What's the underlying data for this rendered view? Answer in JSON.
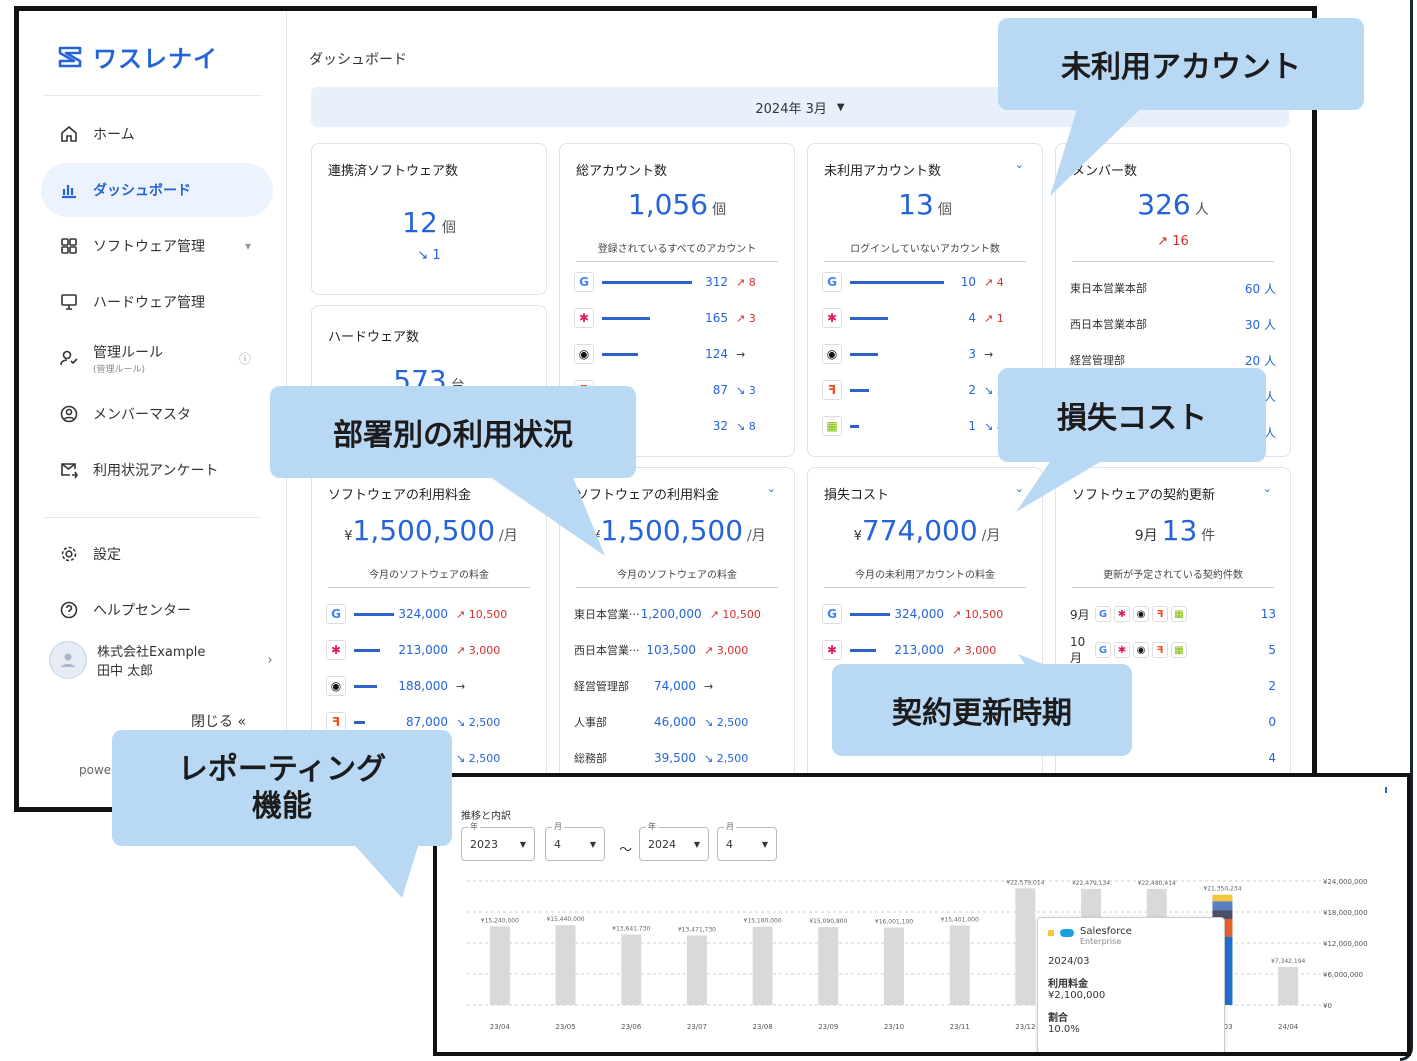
{
  "brand": {
    "name": "ワスレナイ"
  },
  "sidebar": {
    "items": [
      {
        "label": "ホーム"
      },
      {
        "label": "ダッシュボード"
      },
      {
        "label": "ソフトウェア管理"
      },
      {
        "label": "ハードウェア管理"
      },
      {
        "label": "管理ルール",
        "sub": "(管理ルール)"
      },
      {
        "label": "メンバーマスタ"
      },
      {
        "label": "利用状況アンケート"
      },
      {
        "label": "設定"
      },
      {
        "label": "ヘルプセンター"
      }
    ],
    "user_company": "株式会社Example",
    "user_name": "田中 太郎",
    "close_label": "閉じる",
    "close_icon": "«",
    "powered": "powe"
  },
  "header": {
    "title": "ダッシュボード",
    "date": "2024年 3月"
  },
  "cards": {
    "software_count": {
      "title": "連携済ソフトウェア数",
      "value": "12",
      "unit": "個",
      "delta": "↘ 1"
    },
    "hardware_count": {
      "title": "ハードウェア数",
      "value": "573",
      "unit": "台"
    },
    "accounts": {
      "title": "総アカウント数",
      "value": "1,056",
      "unit": "個",
      "sub": "登録されているすべてのアカウント",
      "rows": [
        {
          "icon": "google",
          "val": "312",
          "delta": "↗ 8"
        },
        {
          "icon": "slack",
          "val": "165",
          "delta": "↗ 3"
        },
        {
          "icon": "github",
          "val": "124",
          "delta": "→"
        },
        {
          "icon": "figma",
          "val": "87",
          "delta": "↘ 3"
        },
        {
          "icon": "microsoft",
          "val": "32",
          "delta": "↘ 8"
        }
      ]
    },
    "unused": {
      "title": "未利用アカウント数",
      "value": "13",
      "unit": "個",
      "sub": "ログインしていないアカウント数",
      "rows": [
        {
          "icon": "google",
          "val": "10",
          "delta": "↗ 4"
        },
        {
          "icon": "slack",
          "val": "4",
          "delta": "↗ 1"
        },
        {
          "icon": "github",
          "val": "3",
          "delta": "→"
        },
        {
          "icon": "figma",
          "val": "2",
          "delta": "↘ 3"
        },
        {
          "icon": "microsoft",
          "val": "1",
          "delta": "↘ 8"
        }
      ]
    },
    "members": {
      "title": "メンバー数",
      "value": "326",
      "unit": "人",
      "delta": "↗ 16",
      "rows": [
        {
          "name": "東日本営業本部",
          "val": "60 人"
        },
        {
          "name": "西日本営業本部",
          "val": "30 人"
        },
        {
          "name": "経営管理部",
          "val": "20 人"
        },
        {
          "name": "",
          "val": "人"
        },
        {
          "name": "",
          "val": "人"
        }
      ]
    },
    "fee1": {
      "title": "ソフトウェアの利用料金",
      "prefix": "¥",
      "value": "1,500,500",
      "unit": "/月",
      "sub": "今月のソフトウェアの料金",
      "rows": [
        {
          "icon": "google",
          "val": "324,000",
          "delta": "↗ 10,500"
        },
        {
          "icon": "slack",
          "val": "213,000",
          "delta": "↗ 3,000"
        },
        {
          "icon": "github",
          "val": "188,000",
          "delta": "→"
        },
        {
          "icon": "figma",
          "val": "87,000",
          "delta": "↘ 2,500"
        },
        {
          "icon": "microsoft",
          "val": "0",
          "delta": "↘ 2,500"
        }
      ]
    },
    "fee2": {
      "title": "ソフトウェアの利用料金",
      "prefix": "¥",
      "value": "1,500,500",
      "unit": "/月",
      "sub": "今月のソフトウェアの料金",
      "rows": [
        {
          "name": "東日本営業···",
          "val": "1,200,000",
          "delta": "↗ 10,500"
        },
        {
          "name": "西日本営業···",
          "val": "103,500",
          "delta": "↗ 3,000"
        },
        {
          "name": "経営管理部",
          "val": "74,000",
          "delta": "→"
        },
        {
          "name": "人事部",
          "val": "46,000",
          "delta": "↘ 2,500"
        },
        {
          "name": "総務部",
          "val": "39,500",
          "delta": "↘ 2,500"
        }
      ]
    },
    "loss": {
      "title": "損失コスト",
      "prefix": "¥",
      "value": "774,000",
      "unit": "/月",
      "sub": "今月の未利用アカウントの料金",
      "rows": [
        {
          "icon": "google",
          "val": "324,000",
          "delta": "↗ 10,500"
        },
        {
          "icon": "slack",
          "val": "213,000",
          "delta": "↗ 3,000"
        }
      ]
    },
    "renewal": {
      "title": "ソフトウェアの契約更新",
      "month": "9月",
      "value": "13",
      "unit": "件",
      "sub": "更新が予定されている契約件数",
      "rows": [
        {
          "month": "9月",
          "val": "13"
        },
        {
          "month": "10月",
          "val": "5"
        },
        {
          "month": "",
          "val": "2"
        },
        {
          "month": "",
          "val": "0"
        },
        {
          "month": "",
          "val": "4"
        }
      ]
    }
  },
  "callouts": {
    "unused": "未利用アカウント",
    "dept": "部署別の利用状況",
    "loss": "損失コスト",
    "renewal": "契約更新時期",
    "report1": "レポーティング",
    "report2": "機能"
  },
  "report": {
    "title": "推移と内訳",
    "from_year_label": "年",
    "from_year": "2023",
    "from_month_label": "月",
    "from_month": "4",
    "tilde": "～",
    "to_year_label": "年",
    "to_year": "2024",
    "to_month_label": "月",
    "to_month": "4",
    "tooltip": {
      "vendor": "Salesforce",
      "vendor_sub": "Enterprise",
      "period": "2024/03",
      "fee_label": "利用料金",
      "fee": "¥2,100,000",
      "ratio_label": "割合",
      "ratio": "10.0%"
    }
  },
  "chart_data": {
    "type": "bar",
    "categories": [
      "23/04",
      "23/05",
      "23/06",
      "23/07",
      "23/08",
      "23/09",
      "23/10",
      "23/11",
      "23/12",
      "24/01",
      "24/02",
      "24/03",
      "24/04"
    ],
    "values": [
      15240000,
      15440000,
      13641730,
      13471730,
      15160000,
      15090800,
      15001100,
      15401000,
      22579014,
      22479134,
      22480414,
      21350234,
      7342194
    ],
    "labels": [
      "¥15,240,000",
      "¥15,440,000",
      "¥13,641,730",
      "¥13,471,730",
      "¥15,160,000",
      "¥15,090,800",
      "¥16,001,100",
      "¥15,401,000",
      "¥22,579,014",
      "¥22,479,134",
      "¥22,480,414",
      "¥21,350,234",
      "¥7,342,194"
    ],
    "yticks": [
      "¥24,000,000",
      "¥18,000,000",
      "¥12,000,000",
      "¥6,000,000",
      "¥0"
    ],
    "ylim": [
      0,
      24000000
    ],
    "highlight_index": 11,
    "highlight_colors": [
      "#f5c53a",
      "#5b7fbf",
      "#4a4f6a",
      "#e4612d",
      "#1f6fd0"
    ],
    "bar_color": "#d9d9d9"
  }
}
